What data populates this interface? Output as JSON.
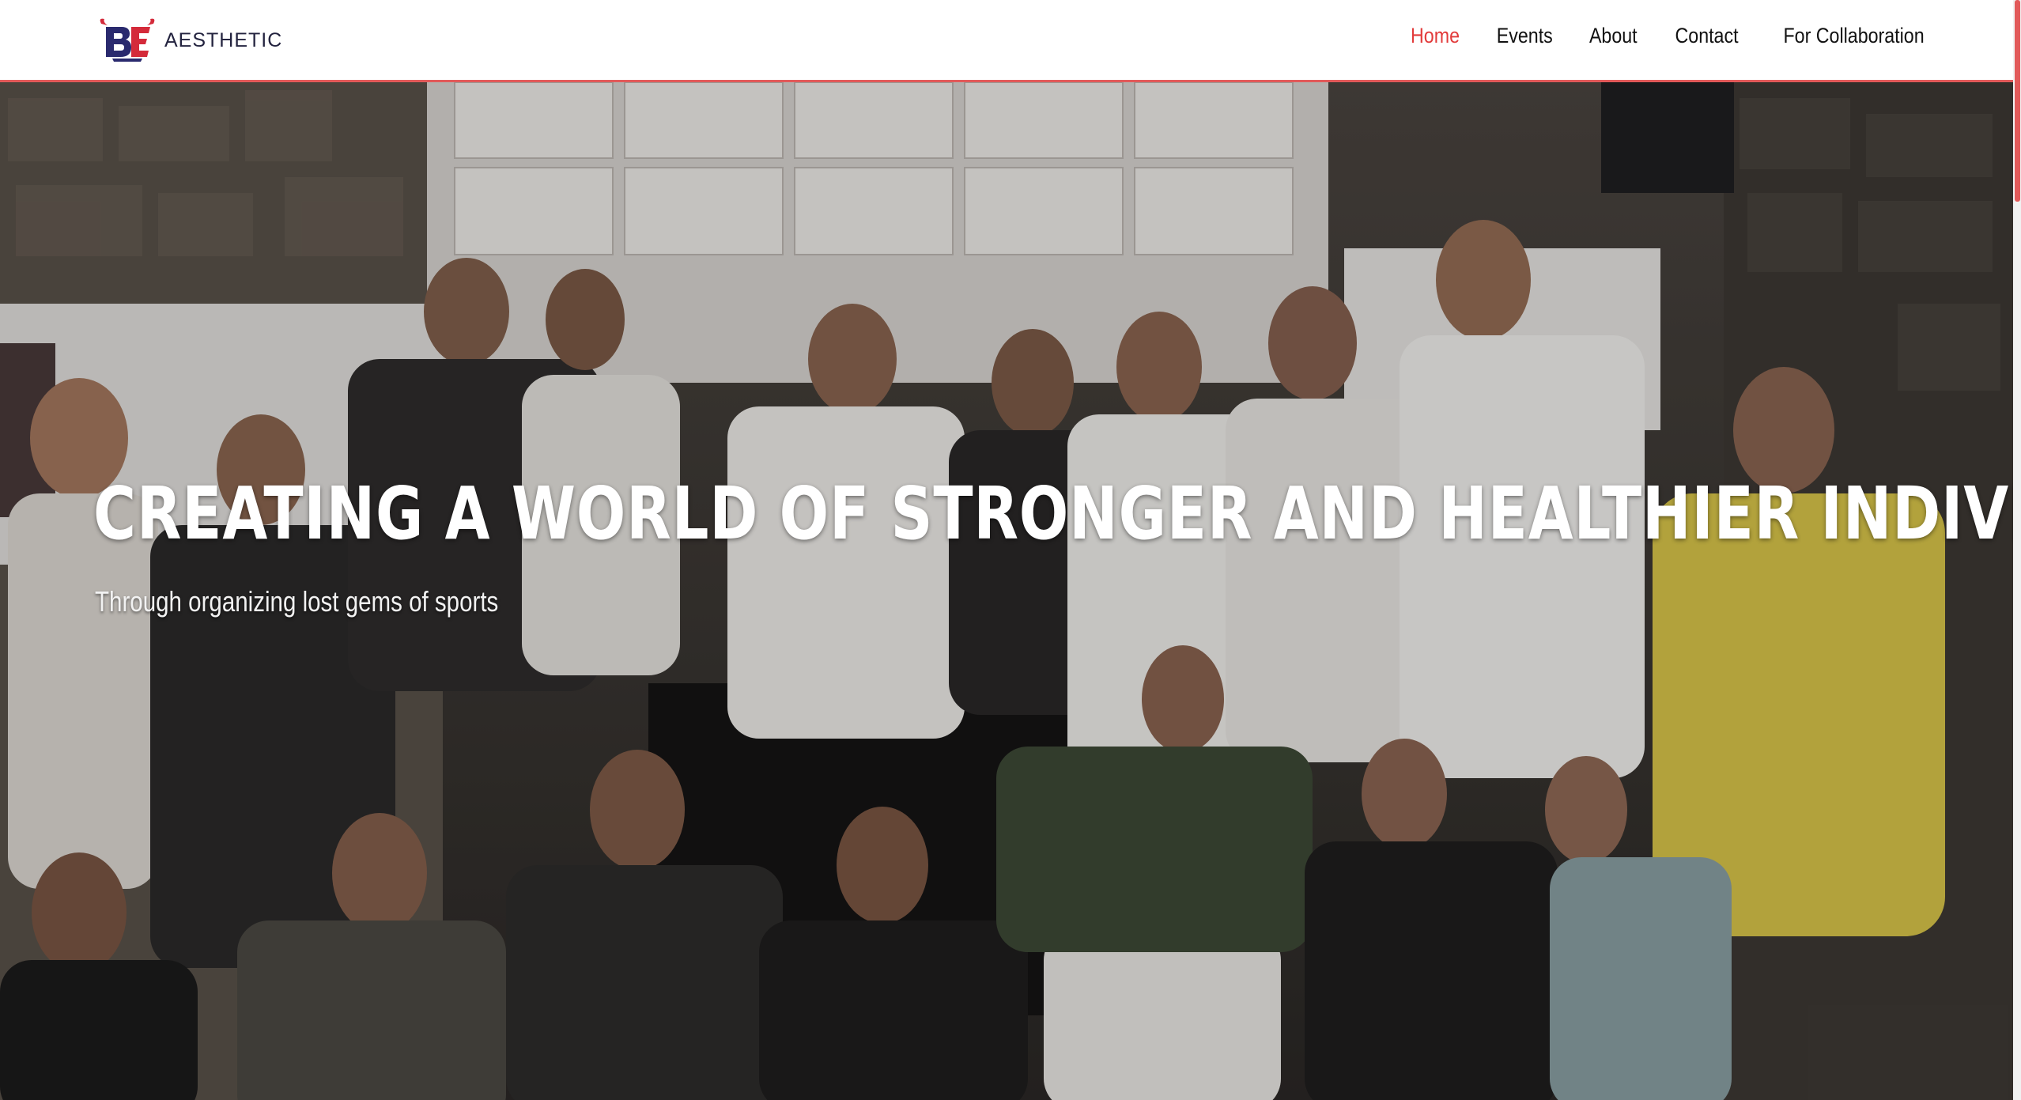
{
  "header": {
    "brand_name": "AESTHETIC",
    "logo_icon": "ae-monogram-logo",
    "nav": [
      {
        "label": "Home",
        "active": true
      },
      {
        "label": "Events",
        "active": false
      },
      {
        "label": "About",
        "active": false
      },
      {
        "label": "Contact",
        "active": false
      },
      {
        "label": "For Collaboration",
        "active": false
      }
    ]
  },
  "hero": {
    "title": "CREATING A WORLD OF STRONGER AND HEALTHIER INDIVIDUALS",
    "subtitle": "Through organizing lost gems of sports",
    "image_description_icon": "group-photo"
  },
  "colors": {
    "accent": "#e23b3b",
    "header_border": "#e25a5a",
    "logo_navy": "#2a2a6e",
    "logo_red": "#d42a3a",
    "text_dark": "#111111"
  }
}
